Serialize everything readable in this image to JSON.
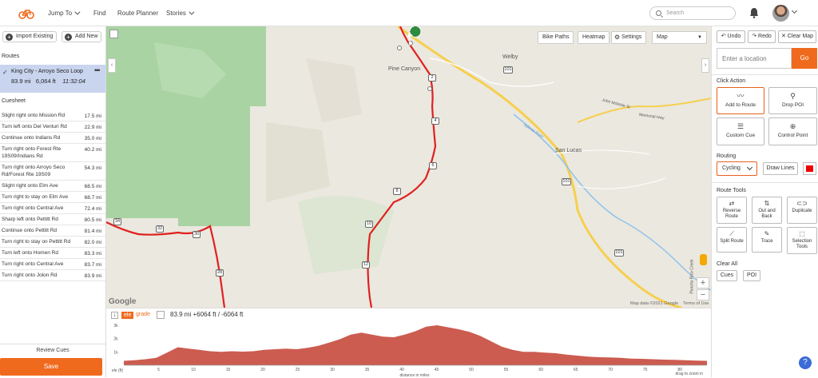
{
  "nav": {
    "items": [
      "Jump To",
      "Find",
      "Route Planner",
      "Stories"
    ],
    "search_placeholder": "Search"
  },
  "left": {
    "import_label": "Import Existing",
    "add_label": "Add New",
    "routes_heading": "Routes",
    "route": {
      "name": "King City - Arroyo Seco Loop",
      "distance": "83.9 mi",
      "elevation": "6,064 ft",
      "time": "11:32:04"
    },
    "cuesheet_heading": "Cuesheet",
    "cues": [
      {
        "text": "Slight right onto Mission Rd",
        "dist": "17.5 mi"
      },
      {
        "text": "Turn left onto Del Venturi Rd",
        "dist": "22.9 mi"
      },
      {
        "text": "Continue onto Indians Rd",
        "dist": "35.0 mi"
      },
      {
        "text": "Turn right onto Forest Rte 19S09/Indians Rd",
        "dist": "40.2 mi"
      },
      {
        "text": "Turn right onto Arroyo Seco Rd/Forest Rte 19S09",
        "dist": "54.3 mi"
      },
      {
        "text": "Slight right onto Elm Ave",
        "dist": "68.5 mi"
      },
      {
        "text": "Turn right to stay on Elm Ave",
        "dist": "68.7 mi"
      },
      {
        "text": "Turn right onto Central Ave",
        "dist": "72.4 mi"
      },
      {
        "text": "Sharp left onto Pettitt Rd",
        "dist": "80.5 mi"
      },
      {
        "text": "Continue onto Pettitt Rd",
        "dist": "81.4 mi"
      },
      {
        "text": "Turn right to stay on Pettitt Rd",
        "dist": "82.0 mi"
      },
      {
        "text": "Turn left onto Homen Rd",
        "dist": "83.3 mi"
      },
      {
        "text": "Turn right onto Central Ave",
        "dist": "83.7 mi"
      },
      {
        "text": "Turn right onto Jolon Rd",
        "dist": "83.9 mi"
      }
    ],
    "review_label": "Review Cues",
    "save_label": "Save"
  },
  "map": {
    "bike_paths": "Bike Paths",
    "heatmap": "Heatmap",
    "settings": "Settings",
    "map_type": "Map",
    "places": [
      "Welby",
      "Pine Canyon",
      "San Lucas"
    ],
    "road_labels": [
      "Salinas River",
      "John Mcbride St",
      "Memorial Hwy",
      "Pancho Rico Creek"
    ],
    "shields": [
      "2",
      "4",
      "6",
      "8",
      "10",
      "12",
      "101",
      "101",
      "101",
      "30",
      "32",
      "28",
      "34"
    ],
    "footer_data": "Map data ©2021 Google",
    "footer_terms": "Terms of Use",
    "google": "Google"
  },
  "elevation": {
    "ele_tab": "ele",
    "grade_tab": "grade",
    "stats": "83.9 mi +6064 ft / -6064 ft",
    "y_ticks": [
      "3k",
      "2k",
      "1k",
      "ele (ft)"
    ],
    "x_ticks": [
      "5",
      "10",
      "15",
      "20",
      "25",
      "30",
      "35",
      "40",
      "45",
      "50",
      "55",
      "60",
      "65",
      "70",
      "75",
      "80"
    ],
    "x_label": "distance in miles",
    "zoom_hint": "drag to zoom in",
    "profile": [
      0.33,
      0.38,
      0.45,
      0.55,
      0.95,
      1.35,
      1.25,
      1.15,
      1.05,
      1.0,
      1.05,
      1.02,
      1.05,
      1.15,
      1.2,
      1.25,
      1.2,
      1.3,
      1.45,
      1.7,
      1.95,
      2.3,
      2.45,
      2.3,
      2.15,
      2.1,
      2.3,
      2.55,
      2.9,
      3.0,
      2.85,
      2.7,
      2.5,
      2.2,
      1.8,
      1.4,
      1.15,
      1.0,
      1.0,
      0.95,
      0.9,
      0.8,
      0.72,
      0.65,
      0.6,
      0.58,
      0.55,
      0.5,
      0.48,
      0.45,
      0.42,
      0.4,
      0.38,
      0.35,
      0.33
    ]
  },
  "right": {
    "undo": "Undo",
    "redo": "Redo",
    "clear_map": "Clear Map",
    "location_placeholder": "Enter a location",
    "go": "Go",
    "click_action": "Click Action",
    "actions": [
      "Add to Route",
      "Drop POI",
      "Custom Cue",
      "Control Point"
    ],
    "routing": "Routing",
    "routing_value": "Cycling",
    "draw_lines": "Draw Lines",
    "route_tools": "Route Tools",
    "tools": [
      "Reverse Route",
      "Out and Back",
      "Duplicate",
      "Split Route",
      "Trace",
      "Selection Tools"
    ],
    "clear_all": "Clear All",
    "clear_cues": "Cues",
    "clear_poi": "POI",
    "accent": "#e8601c",
    "route_color": "#e02020"
  }
}
